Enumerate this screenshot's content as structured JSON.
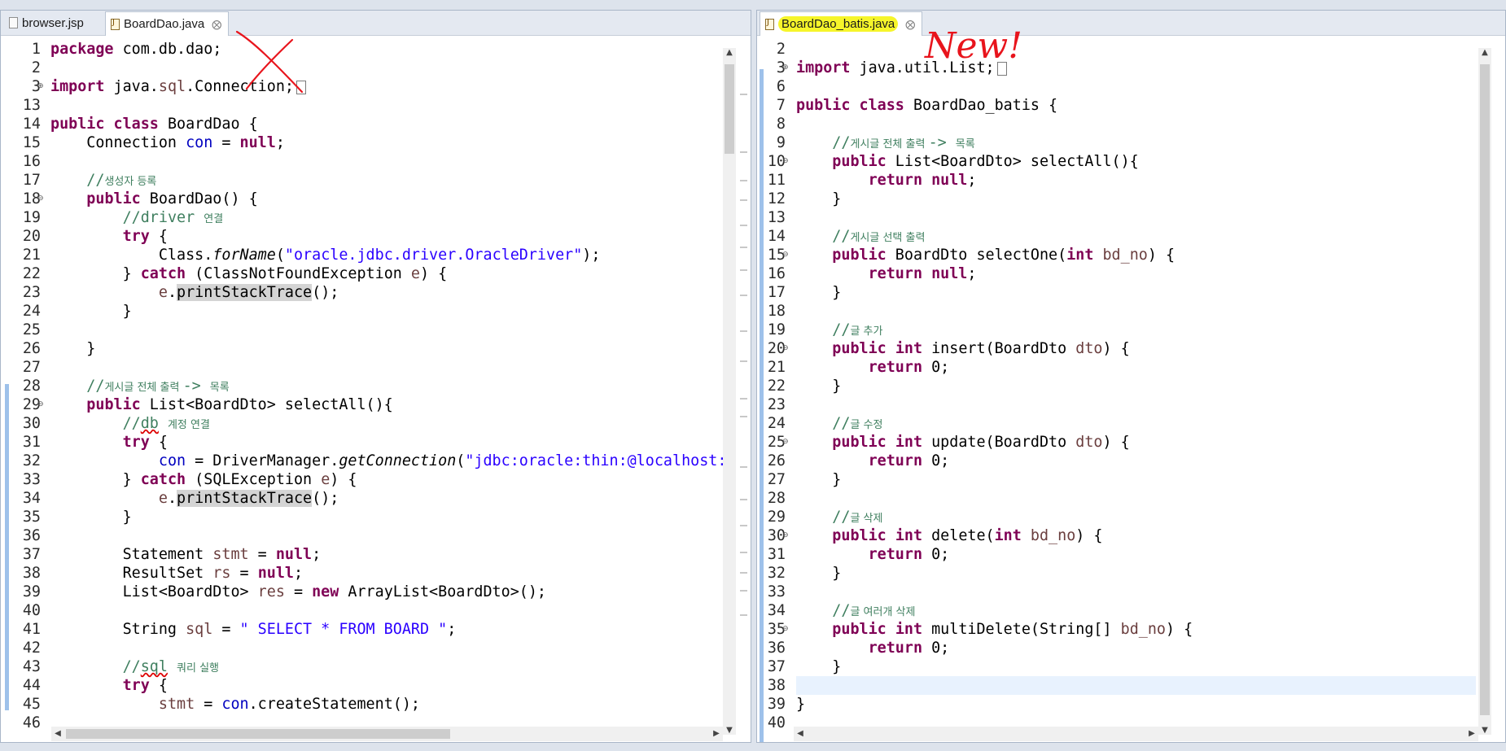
{
  "left": {
    "tabs": [
      {
        "label": "browser.jsp",
        "icon": "jsp-file-icon"
      },
      {
        "label": "BoardDao.java",
        "icon": "java-file-icon",
        "active": true
      }
    ],
    "close_glyph": "⨂",
    "lines": [
      {
        "n": "1",
        "t": "package com.db.dao;"
      },
      {
        "n": "2",
        "t": ""
      },
      {
        "n": "3",
        "t": "import java.sql.Connection;",
        "fold": "plus"
      },
      {
        "n": "13",
        "t": ""
      },
      {
        "n": "14",
        "t": "public class BoardDao {"
      },
      {
        "n": "15",
        "t": "    Connection con = null;"
      },
      {
        "n": "16",
        "t": ""
      },
      {
        "n": "17",
        "t": "    //생성자 등록"
      },
      {
        "n": "18",
        "t": "    public BoardDao() {",
        "fold": "minus"
      },
      {
        "n": "19",
        "t": "        //driver 연결"
      },
      {
        "n": "20",
        "t": "        try {"
      },
      {
        "n": "21",
        "t": "            Class.forName(\"oracle.jdbc.driver.OracleDriver\");"
      },
      {
        "n": "22",
        "t": "        } catch (ClassNotFoundException e) {"
      },
      {
        "n": "23",
        "t": "            e.printStackTrace();"
      },
      {
        "n": "24",
        "t": "        }"
      },
      {
        "n": "25",
        "t": ""
      },
      {
        "n": "26",
        "t": "    }"
      },
      {
        "n": "27",
        "t": ""
      },
      {
        "n": "28",
        "t": "    //게시글 전체 출력 -> 목록"
      },
      {
        "n": "29",
        "t": "    public List<BoardDto> selectAll(){",
        "fold": "minus"
      },
      {
        "n": "30",
        "t": "        //db 계정 연결"
      },
      {
        "n": "31",
        "t": "        try {"
      },
      {
        "n": "32",
        "t": "            con = DriverManager.getConnection(\"jdbc:oracle:thin:@localhost:"
      },
      {
        "n": "33",
        "t": "        } catch (SQLException e) {"
      },
      {
        "n": "34",
        "t": "            e.printStackTrace();"
      },
      {
        "n": "35",
        "t": "        }"
      },
      {
        "n": "36",
        "t": ""
      },
      {
        "n": "37",
        "t": "        Statement stmt = null;"
      },
      {
        "n": "38",
        "t": "        ResultSet rs = null;"
      },
      {
        "n": "39",
        "t": "        List<BoardDto> res = new ArrayList<BoardDto>();"
      },
      {
        "n": "40",
        "t": ""
      },
      {
        "n": "41",
        "t": "        String sql = \" SELECT * FROM BOARD \";"
      },
      {
        "n": "42",
        "t": ""
      },
      {
        "n": "43",
        "t": "        //sql 쿼리 실행"
      },
      {
        "n": "44",
        "t": "        try {"
      },
      {
        "n": "45",
        "t": "            stmt = con.createStatement();"
      },
      {
        "n": "46",
        "t": ""
      }
    ]
  },
  "right": {
    "tabs": [
      {
        "label": "BoardDao_batis.java",
        "icon": "java-file-icon",
        "active": true
      }
    ],
    "close_glyph": "⨂",
    "annotation": "New!",
    "lines": [
      {
        "n": "2",
        "t": ""
      },
      {
        "n": "3",
        "t": "import java.util.List;",
        "fold": "plus"
      },
      {
        "n": "6",
        "t": ""
      },
      {
        "n": "7",
        "t": "public class BoardDao_batis {"
      },
      {
        "n": "8",
        "t": ""
      },
      {
        "n": "9",
        "t": "    //게시글 전체 출력 -> 목록"
      },
      {
        "n": "10",
        "t": "    public List<BoardDto> selectAll(){",
        "fold": "minus"
      },
      {
        "n": "11",
        "t": "        return null;"
      },
      {
        "n": "12",
        "t": "    }"
      },
      {
        "n": "13",
        "t": ""
      },
      {
        "n": "14",
        "t": "    //게시글 선택 출력"
      },
      {
        "n": "15",
        "t": "    public BoardDto selectOne(int bd_no) {",
        "fold": "minus"
      },
      {
        "n": "16",
        "t": "        return null;"
      },
      {
        "n": "17",
        "t": "    }"
      },
      {
        "n": "18",
        "t": ""
      },
      {
        "n": "19",
        "t": "    //글 추가"
      },
      {
        "n": "20",
        "t": "    public int insert(BoardDto dto) {",
        "fold": "minus"
      },
      {
        "n": "21",
        "t": "        return 0;"
      },
      {
        "n": "22",
        "t": "    }"
      },
      {
        "n": "23",
        "t": ""
      },
      {
        "n": "24",
        "t": "    //글 수정"
      },
      {
        "n": "25",
        "t": "    public int update(BoardDto dto) {",
        "fold": "minus"
      },
      {
        "n": "26",
        "t": "        return 0;"
      },
      {
        "n": "27",
        "t": "    }"
      },
      {
        "n": "28",
        "t": ""
      },
      {
        "n": "29",
        "t": "    //글 삭제"
      },
      {
        "n": "30",
        "t": "    public int delete(int bd_no) {",
        "fold": "minus"
      },
      {
        "n": "31",
        "t": "        return 0;"
      },
      {
        "n": "32",
        "t": "    }"
      },
      {
        "n": "33",
        "t": ""
      },
      {
        "n": "34",
        "t": "    //글 여러개 삭제"
      },
      {
        "n": "35",
        "t": "    public int multiDelete(String[] bd_no) {",
        "fold": "minus"
      },
      {
        "n": "36",
        "t": "        return 0;"
      },
      {
        "n": "37",
        "t": "    }"
      },
      {
        "n": "38",
        "t": ""
      },
      {
        "n": "39",
        "t": "}"
      },
      {
        "n": "40",
        "t": ""
      }
    ]
  },
  "colors": {
    "keyword": "#7f0055",
    "string": "#2a00ff",
    "comment": "#3f7f5f",
    "field": "#0000c0",
    "local_var": "#6a3e3e",
    "tab_highlight": "#f6f52a",
    "annotation_red": "#e8141c"
  }
}
